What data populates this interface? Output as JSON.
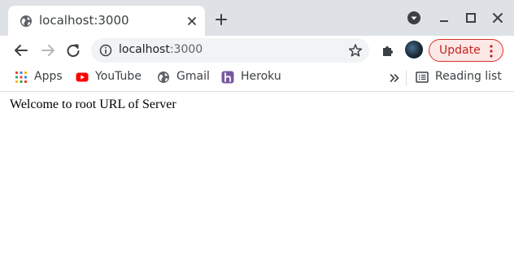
{
  "tab": {
    "title": "localhost:3000"
  },
  "window": {
    "tabstrip_color": "#dee1e6",
    "controls": [
      "profile-menu-icon",
      "minimize-icon",
      "maximize-icon",
      "close-icon"
    ]
  },
  "toolbar": {
    "url_host": "localhost",
    "url_port": ":3000",
    "update_label": "Update",
    "update_color": "#d93025"
  },
  "bookmarks": {
    "items": [
      {
        "label": "Apps",
        "icon": "apps-grid-icon"
      },
      {
        "label": "YouTube",
        "icon": "youtube-icon"
      },
      {
        "label": "Gmail",
        "icon": "globe-icon"
      },
      {
        "label": "Heroku",
        "icon": "heroku-icon"
      }
    ],
    "reading_list_label": "Reading list"
  },
  "page": {
    "text": "Welcome to root URL of Server"
  }
}
